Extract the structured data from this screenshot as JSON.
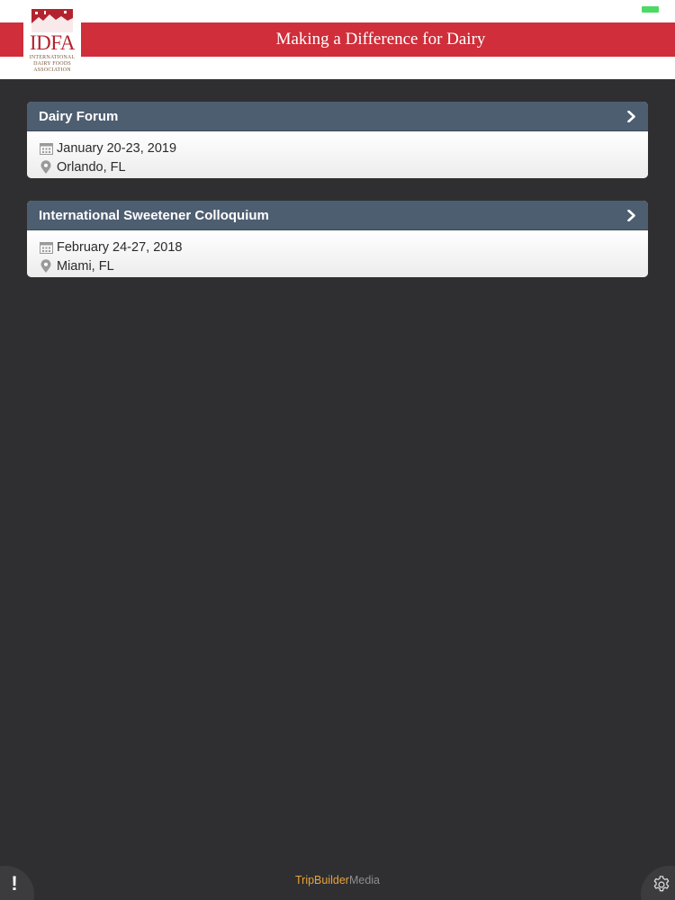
{
  "header": {
    "tagline": "Making a Difference for Dairy",
    "logo": {
      "abbr": "IDFA",
      "line1": "INTERNATIONAL",
      "line2": "DAIRY FOODS",
      "line3": "ASSOCIATION"
    },
    "battery_color": "#4cd964",
    "brand_color": "#cf2e3a"
  },
  "events": [
    {
      "title": "Dairy Forum",
      "date": "January 20-23, 2019",
      "location": "Orlando, FL"
    },
    {
      "title": "International Sweetener Colloquium",
      "date": "February 24-27, 2018",
      "location": "Miami, FL"
    }
  ],
  "icons": {
    "chevron": "chevron-right-icon",
    "date": "calendar-icon",
    "location": "map-pin-icon",
    "alert": "exclamation-icon",
    "settings": "gear-icon"
  },
  "footer": {
    "brand_part1": "TripBuilder",
    "brand_part2": "Media",
    "alert_glyph": "!"
  }
}
